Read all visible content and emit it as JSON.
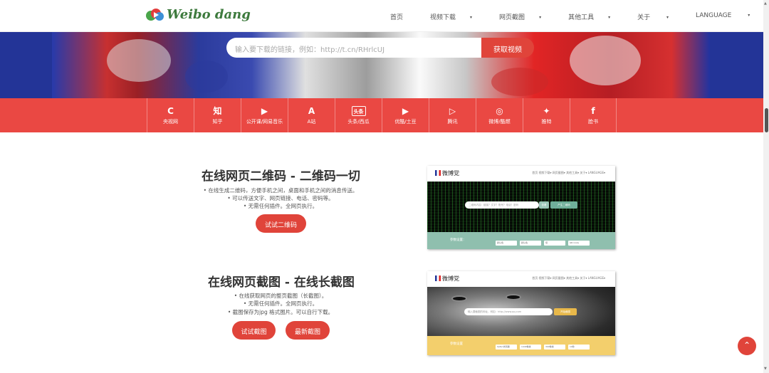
{
  "brand": {
    "name": "Weibo dang"
  },
  "nav": [
    {
      "label": "首页",
      "caret": false
    },
    {
      "label": "视频下载",
      "caret": true
    },
    {
      "label": "网页截图",
      "caret": true
    },
    {
      "label": "其他工具",
      "caret": true
    },
    {
      "label": "关于",
      "caret": true
    },
    {
      "label": "LANGUAGE",
      "caret": true
    }
  ],
  "caret": "▾",
  "search": {
    "placeholder": "输入要下载的链接，例如：http://t.cn/RHrlcUJ",
    "button_label": "获取视频"
  },
  "platforms": [
    {
      "icon": "cctv-icon",
      "glyph": "C",
      "label": "央视网"
    },
    {
      "icon": "zhihu-icon",
      "glyph": "知",
      "label": "知乎"
    },
    {
      "icon": "video-play-icon",
      "glyph": "▶",
      "label": "公开课/网易音乐"
    },
    {
      "icon": "acfun-icon",
      "glyph": "A",
      "label": "A站"
    },
    {
      "icon": "toutiao-icon",
      "glyph": "头条",
      "label": "头条/西瓜"
    },
    {
      "icon": "youku-icon",
      "glyph": "▶",
      "label": "优酷/土豆"
    },
    {
      "icon": "tencent-video-icon",
      "glyph": "▷",
      "label": "腾讯"
    },
    {
      "icon": "weibo-icon",
      "glyph": "◎",
      "label": "微博/酷燃"
    },
    {
      "icon": "twitter-icon",
      "glyph": "✦",
      "label": "推特"
    },
    {
      "icon": "facebook-icon",
      "glyph": "f",
      "label": "脸书"
    }
  ],
  "qr_section": {
    "title": "在线网页二维码 - 二维码一切",
    "bullets": [
      "•  在线生成二维码，方便手机之间，桌面和手机之间的消息传送。",
      "•  可以传送文字、网页链接、电话、密码等。",
      "•  无需任何插件。全网页执行。"
    ],
    "button_label": "试试二维码"
  },
  "screenshot_section": {
    "title": "在线网页截图 - 在线长截图",
    "bullets": [
      "•  在线获取网页的整页截图（长截图）。",
      "•  无需任何插件。全网页执行。",
      "•  截图保存为jpg 格式图片。可以自行下载。"
    ],
    "buttons": [
      "试试截图",
      "最新截图"
    ]
  },
  "preview": {
    "logo": "微博党",
    "nav": "首页    视频下载▾    网页截图▾    其他工具▾    关于▾    LANGUAGE▾",
    "qr_placeholder": "二维码内容：链接？文字？账号？电话？密码",
    "qr_buttons": [
      "查看",
      "产生二维码"
    ],
    "qr_param_label": "参数设置：",
    "qr_selects": [
      "默认色",
      "默认色",
      "低",
      "QR Code"
    ],
    "shot_placeholder": "输入要截图的网址，例如：http://www.qq.com",
    "shot_button": "开始截图",
    "shot_param_label": "参数设置",
    "shot_selects": [
      "Safari浏览器",
      "1440像素",
      "300像素",
      "10秒"
    ]
  },
  "scroll_top_icon": "⌃",
  "colors": {
    "accent": "#e0443a",
    "platform_bar": "#ea4843",
    "logo_green": "#3d7a3d"
  }
}
